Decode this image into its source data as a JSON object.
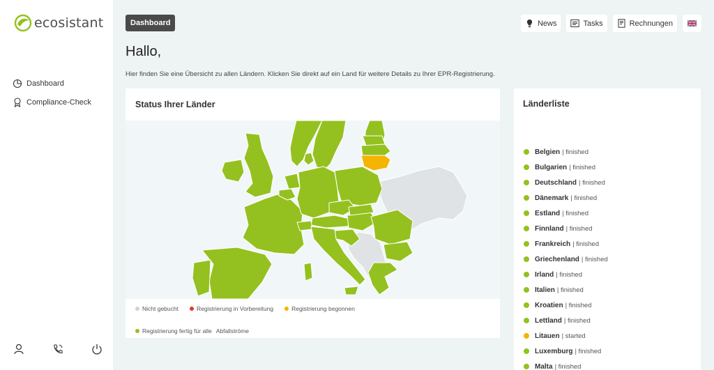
{
  "app": {
    "logo_text": "ecosistant"
  },
  "sidebar": {
    "items": [
      {
        "label": "Dashboard",
        "icon": "dashboard-icon"
      },
      {
        "label": "Compliance-Check",
        "icon": "award-icon"
      }
    ],
    "bottom_icons": [
      "user-icon",
      "phone-icon",
      "power-icon"
    ]
  },
  "header": {
    "badge": "Dashboard",
    "buttons": [
      {
        "label": "News",
        "icon": "bulb-icon"
      },
      {
        "label": "Tasks",
        "icon": "tasks-icon"
      },
      {
        "label": "Rechnungen",
        "icon": "invoice-icon"
      }
    ],
    "language_icon": "uk-flag-icon"
  },
  "main": {
    "greeting": "Hallo,",
    "intro": "Hier finden Sie eine Übersicht zu allen Ländern. Klicken Sie direkt auf ein Land für weitere Details zu Ihrer EPR-Registrierung."
  },
  "map_card": {
    "title": "Status Ihrer Länder",
    "legend": [
      {
        "label": "Nicht gebucht",
        "color": "#cfd3d6"
      },
      {
        "label": "Registrierung in Vorbereitung",
        "color": "#e03a1e"
      },
      {
        "label": "Registrierung begonnen",
        "color": "#f5b400"
      },
      {
        "label": "Registrierung fertig für alle",
        "color": "#94c11f"
      },
      {
        "label": "Abfallströme",
        "color": ""
      }
    ]
  },
  "country_list": {
    "title": "Länderliste",
    "items": [
      {
        "name": "Belgien",
        "status": "| finished",
        "color": "#94c11f"
      },
      {
        "name": "Bulgarien",
        "status": "| finished",
        "color": "#94c11f"
      },
      {
        "name": "Deutschland",
        "status": "| finished",
        "color": "#94c11f"
      },
      {
        "name": "Dänemark",
        "status": "| finished",
        "color": "#94c11f"
      },
      {
        "name": "Estland",
        "status": "| finished",
        "color": "#94c11f"
      },
      {
        "name": "Finnland",
        "status": "| finished",
        "color": "#94c11f"
      },
      {
        "name": "Frankreich",
        "status": "| finished",
        "color": "#94c11f"
      },
      {
        "name": "Griechenland",
        "status": "| finished",
        "color": "#94c11f"
      },
      {
        "name": "Irland",
        "status": "| finished",
        "color": "#94c11f"
      },
      {
        "name": "Italien",
        "status": "| finished",
        "color": "#94c11f"
      },
      {
        "name": "Kroatien",
        "status": "| finished",
        "color": "#94c11f"
      },
      {
        "name": "Lettland",
        "status": "| finished",
        "color": "#94c11f"
      },
      {
        "name": "Litauen",
        "status": "| started",
        "color": "#f5b400"
      },
      {
        "name": "Luxemburg",
        "status": "| finished",
        "color": "#94c11f"
      },
      {
        "name": "Malta",
        "status": "| finished",
        "color": "#94c11f"
      }
    ]
  },
  "colors": {
    "finished": "#94c11f",
    "started": "#f5b400",
    "not_booked": "#dfe3e6"
  }
}
